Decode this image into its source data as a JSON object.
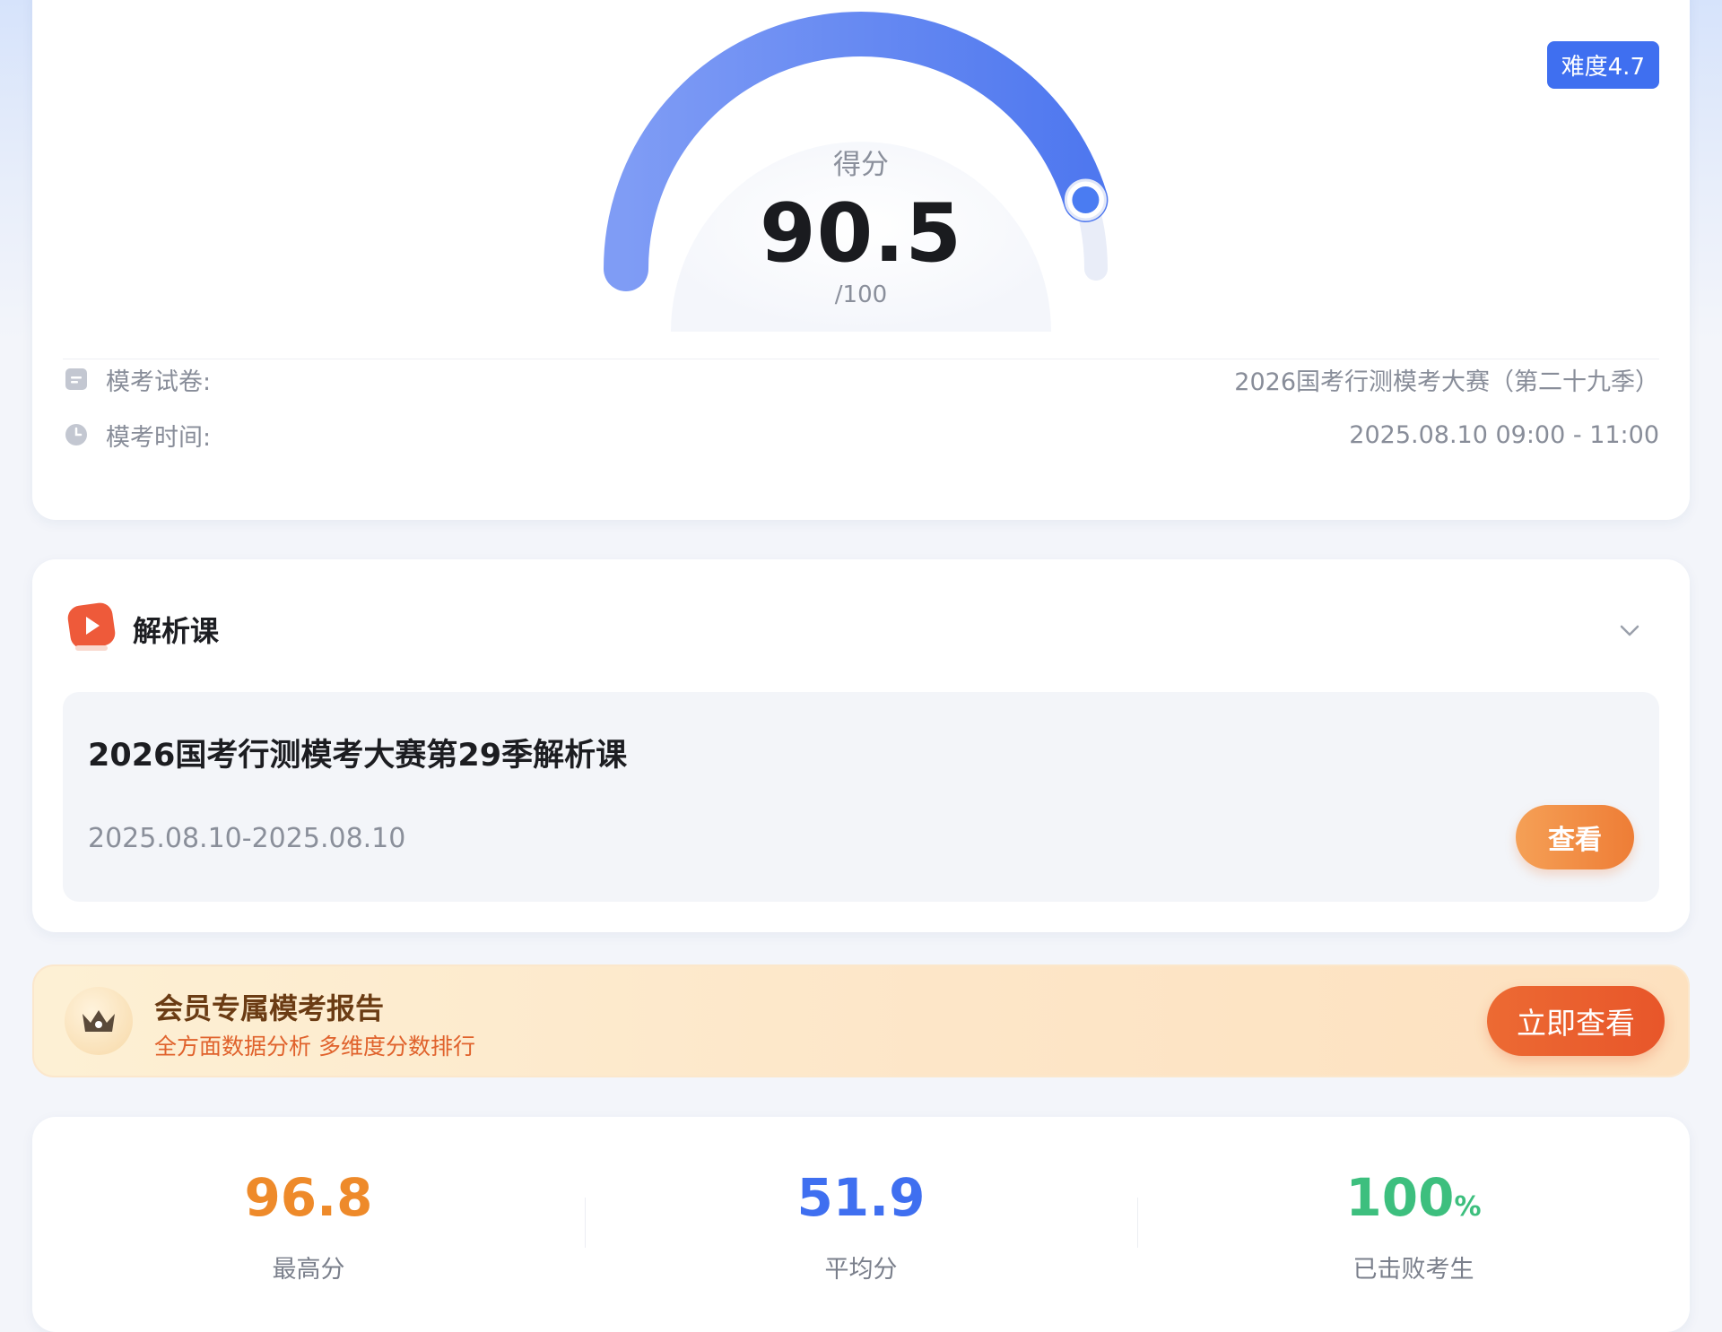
{
  "score": {
    "label": "得分",
    "value": "90.5",
    "max": "/100",
    "fraction": 0.905,
    "difficulty": "难度4.7"
  },
  "exam_info": {
    "paper_label": "模考试卷:",
    "paper_value": "2026国考行测模考大赛（第二十九季）",
    "time_label": "模考时间:",
    "time_value": "2025.08.10 09:00 - 11:00"
  },
  "course": {
    "section_title": "解析课",
    "item_name": "2026国考行测模考大赛第29季解析课",
    "item_date": "2025.08.10-2025.08.10",
    "view_label": "查看"
  },
  "member": {
    "title": "会员专属模考报告",
    "subtitle": "全方面数据分析 多维度分数排行",
    "button": "立即查看"
  },
  "stats": [
    {
      "value": "96.8",
      "unit": "",
      "label": "最高分",
      "color": "#ee8a2a"
    },
    {
      "value": "51.9",
      "unit": "",
      "label": "平均分",
      "color": "#3f6ff0"
    },
    {
      "value": "100",
      "unit": "%",
      "label": "已击败考生",
      "color": "#3dbf7e"
    }
  ],
  "icons": {
    "paper": "document-icon",
    "time": "clock-icon",
    "course": "play-icon",
    "collapse": "chevron-down-icon",
    "member": "crown-icon"
  }
}
